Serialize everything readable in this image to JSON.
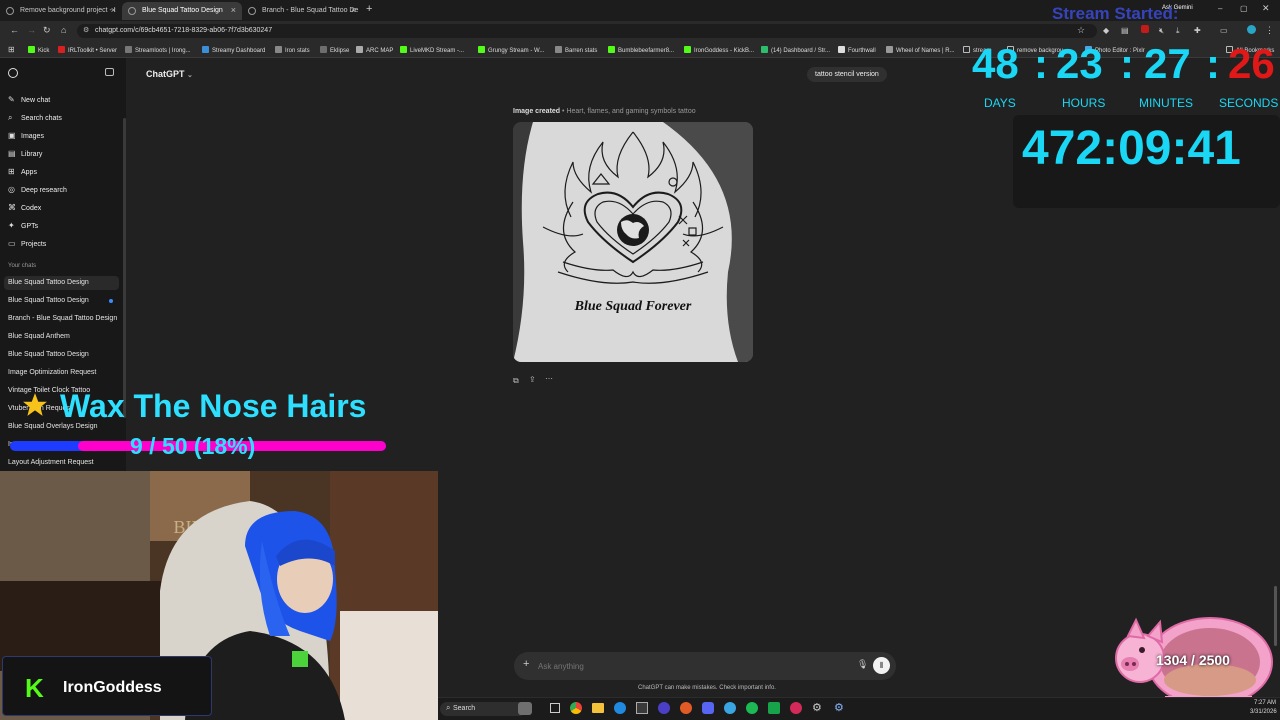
{
  "browser": {
    "tabs": [
      {
        "label": "Remove background project - I"
      },
      {
        "label": "Blue Squad Tattoo Design"
      },
      {
        "label": "Branch - Blue Squad Tattoo De"
      }
    ],
    "url": "chatgpt.com/c/69cb4651-7218-8329-ab06-7f7d3b630247",
    "ask_gemini": "Ask Gemini",
    "bookmarks": [
      "Kick",
      "IRLToolkit • Server",
      "Streamloots | Irong...",
      "Streamy Dashboard",
      "Iron stats",
      "Eklipse",
      "ARC MAP",
      "LiveMKD Stream -...",
      "Grungy Stream - W...",
      "Barren stats",
      "Bumblebeefarmer8...",
      "IronGoddess - KickB...",
      "(14) Dashboard / Str...",
      "Fourthwall",
      "Wheel of Names | R...",
      "stream",
      "remove backgrou",
      "Photo Editor : Pixlr",
      "All Bookmarks"
    ]
  },
  "sidebar": {
    "nav": [
      {
        "label": "New chat",
        "icon": "✎"
      },
      {
        "label": "Search chats",
        "icon": "⌕"
      },
      {
        "label": "Images",
        "icon": "▣"
      },
      {
        "label": "Library",
        "icon": "▤"
      },
      {
        "label": "Apps",
        "icon": "⊞"
      },
      {
        "label": "Deep research",
        "icon": "◎"
      },
      {
        "label": "Codex",
        "icon": "⌘"
      },
      {
        "label": "GPTs",
        "icon": "✦"
      },
      {
        "label": "Projects",
        "icon": "▭"
      }
    ],
    "section_label": "Your chats",
    "chats": [
      "Blue Squad Tattoo Design",
      "Blue Squad Tattoo Design",
      "Branch - Blue Squad Tattoo Design",
      "Blue Squad Anthem",
      "Blue Squad Tattoo Design",
      "Image Optimization Request",
      "Vintage Toilet Clock Tattoo",
      "Vtuber Icon Request",
      "Blue Squad Overlays Design",
      "In",
      "Layout Adjustment Request"
    ]
  },
  "main": {
    "model_label": "ChatGPT",
    "user_bubble": "tattoo stencil version",
    "image_created_label": "Image created",
    "image_caption": "• Heart, flames, and gaming symbols tattoo",
    "tattoo_text": "Blue Squad Forever",
    "composer_placeholder": "Ask anything",
    "disclaimer": "ChatGPT can make mistakes. Check important info."
  },
  "overlay": {
    "stream_started": "Stream Started:",
    "countdown": {
      "days": "48",
      "hours": "23",
      "minutes": "27",
      "seconds": "26"
    },
    "unit_labels": {
      "days": "DAYS",
      "hours": "HOURS",
      "minutes": "MINUTES",
      "seconds": "SECONDS"
    },
    "elapsed": "472:09:41",
    "goal_title": "Wax The Nose Hairs",
    "goal_progress_text": "9 / 50 (18%)",
    "goal_fraction": 0.18,
    "piggy_text": "1304 / 2500",
    "streamer_name": "IronGoddess"
  },
  "taskbar": {
    "search_label": "Search",
    "time": "7:27 AM",
    "date": "3/31/2026"
  },
  "colors": {
    "accent_cyan": "#19d7f5",
    "goal_text": "#2ee0ff",
    "goal_bar": "#ff00cc",
    "goal_bar_bg": "#1e3cff",
    "kick_green": "#53fc18",
    "seconds_red": "#e01818",
    "stream_started_blue": "#3b4bd8"
  }
}
